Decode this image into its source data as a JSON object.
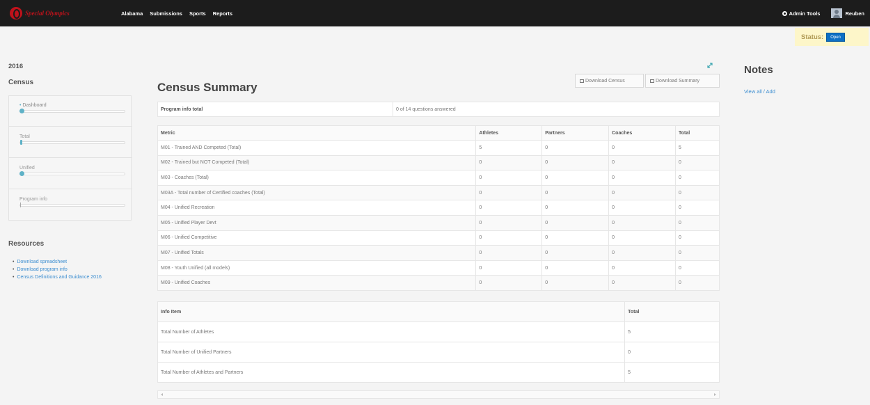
{
  "navbar": {
    "brand": "Special Olympics",
    "links": [
      "Alabama",
      "Submissions",
      "Sports",
      "Reports"
    ],
    "admin_tools": "Admin Tools",
    "user": "Reuben"
  },
  "status": {
    "label": "Status:",
    "value": "Open"
  },
  "sidebar": {
    "year": "2016",
    "census_heading": "Census",
    "progress_items": [
      {
        "label": "Dashboard",
        "progress": 0.04
      },
      {
        "label": "Total",
        "progress": 0.01
      },
      {
        "label": "Unified",
        "progress": 0.03
      },
      {
        "label": "Program info",
        "progress": 0.0
      }
    ],
    "resources_heading": "Resources",
    "resources": [
      "Download spreadsheet",
      "Download program info",
      "Census Definitions and Guidance 2016"
    ]
  },
  "main": {
    "title": "Census Summary",
    "download_census": "Download Census",
    "download_summary": "Download Summary",
    "program_info_label": "Program info total",
    "program_info_value": "0 of 14 questions answered",
    "metric_headers": [
      "Metric",
      "Athletes",
      "Partners",
      "Coaches",
      "Total"
    ],
    "metrics": [
      [
        "M01 - Trained AND Competed (Total)",
        "5",
        "0",
        "0",
        "5"
      ],
      [
        "M02 - Trained but NOT Competed (Total)",
        "0",
        "0",
        "0",
        "0"
      ],
      [
        "M03 - Coaches (Total)",
        "0",
        "0",
        "0",
        "0"
      ],
      [
        "M03A - Total number of Certified coaches (Total)",
        "0",
        "0",
        "0",
        "0"
      ],
      [
        "M04 - Unified Recreation",
        "0",
        "0",
        "0",
        "0"
      ],
      [
        "M05 - Unified Player Devt",
        "0",
        "0",
        "0",
        "0"
      ],
      [
        "M06 - Unified Competitive",
        "0",
        "0",
        "0",
        "0"
      ],
      [
        "M07 - Unified Totals",
        "0",
        "0",
        "0",
        "0"
      ],
      [
        "M08 - Youth Unified (all models)",
        "0",
        "0",
        "0",
        "0"
      ],
      [
        "M09 - Unified Coaches",
        "0",
        "0",
        "0",
        "0"
      ]
    ],
    "info_headers": [
      "Info Item",
      "Total"
    ],
    "info_items": [
      [
        "Total Number of Athletes",
        "5"
      ],
      [
        "Total Number of Unified Partners",
        "0"
      ],
      [
        "Total Number of Athletes and Partners",
        "5"
      ]
    ]
  },
  "notes": {
    "heading": "Notes",
    "link": "View all / Add"
  },
  "colors": {
    "navbar": "#1c1c1c",
    "brand": "#c0121b",
    "status_bg": "#fdf6c9",
    "status_button": "#0d6fc4",
    "link": "#3b8dd0",
    "progress": "#5fb2c7"
  },
  "icons": [
    "gear-icon",
    "user-avatar",
    "expand-icon",
    "printer-icon"
  ]
}
